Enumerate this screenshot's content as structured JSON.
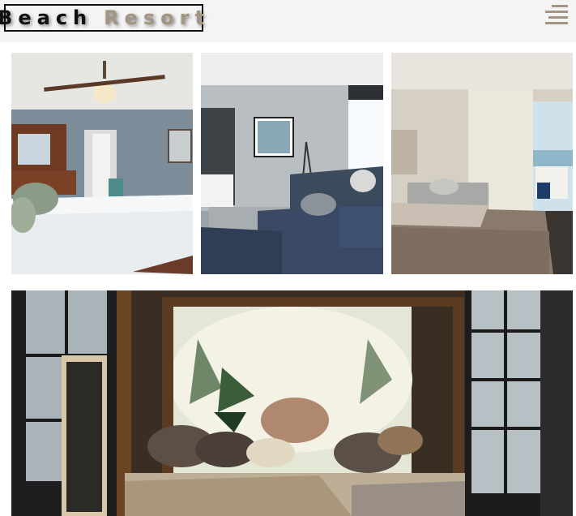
{
  "header": {
    "logo_word1": "Beach",
    "logo_word2": "Resort",
    "menu_icon": "hamburger-menu-icon"
  },
  "colors": {
    "background": "#f4f4f4",
    "logo_dark": "#111111",
    "accent": "#a49482"
  },
  "gallery": {
    "images": [
      {
        "name": "bedroom-ceiling-fan-photo"
      },
      {
        "name": "living-room-sofa-photo"
      },
      {
        "name": "balcony-bedroom-photo"
      },
      {
        "name": "canopy-bed-photo"
      }
    ]
  }
}
